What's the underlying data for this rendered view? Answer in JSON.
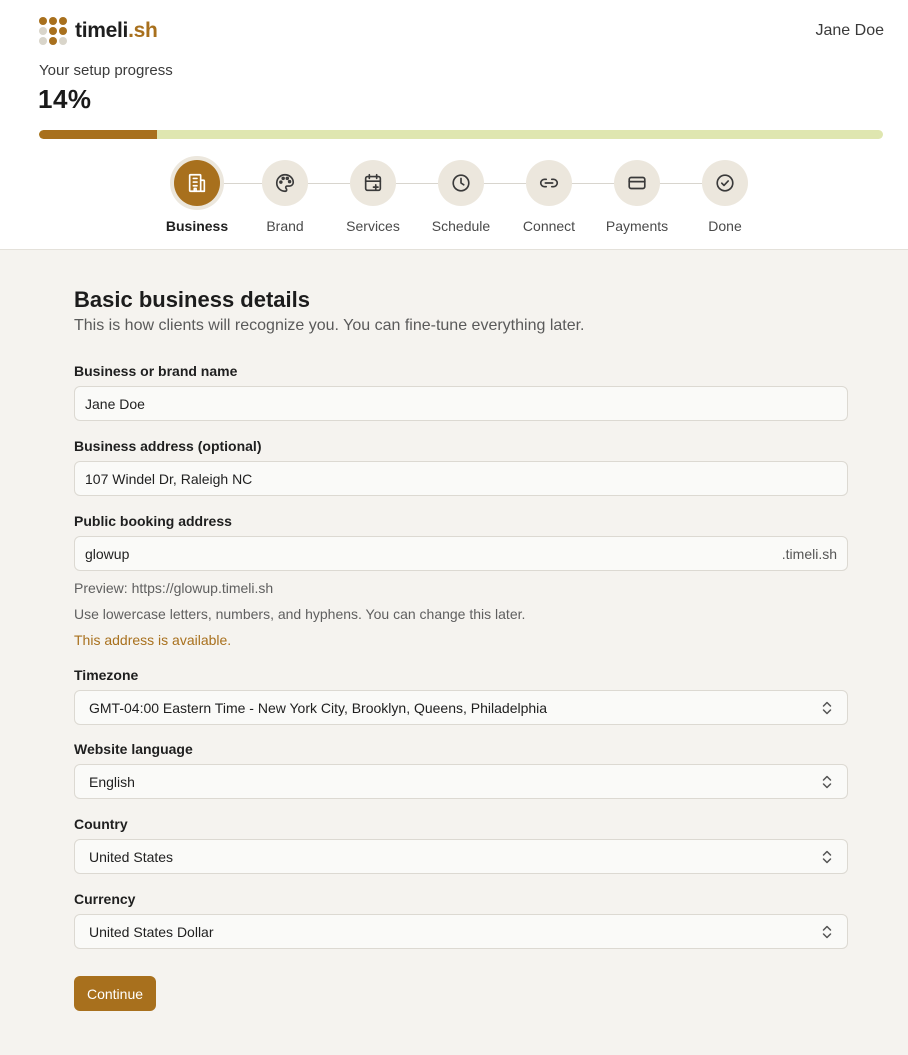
{
  "app": {
    "logo_text_main": "timeli",
    "logo_text_accent": ".sh",
    "user_name": "Jane Doe",
    "colors": {
      "accent": "#a8701d",
      "track": "#dfe6b0",
      "dots_gold": "#a8701d",
      "dots_light": "#d9d5ca"
    }
  },
  "progress": {
    "label": "Your setup progress",
    "percent_text": "14%",
    "fraction": 0.14
  },
  "steps": [
    {
      "label": "Business",
      "icon": "building-icon",
      "active": true
    },
    {
      "label": "Brand",
      "icon": "palette-icon",
      "active": false
    },
    {
      "label": "Services",
      "icon": "calendar-plus-icon",
      "active": false
    },
    {
      "label": "Schedule",
      "icon": "clock-icon",
      "active": false
    },
    {
      "label": "Connect",
      "icon": "link-icon",
      "active": false
    },
    {
      "label": "Payments",
      "icon": "credit-card-icon",
      "active": false
    },
    {
      "label": "Done",
      "icon": "check-circle-icon",
      "active": false
    }
  ],
  "form": {
    "title": "Basic business details",
    "subtitle": "This is how clients will recognize you. You can fine-tune everything later.",
    "business_name": {
      "label": "Business or brand name",
      "value": "Jane Doe"
    },
    "business_address": {
      "label": "Business address (optional)",
      "value": "107 Windel Dr, Raleigh NC"
    },
    "booking_address": {
      "label": "Public booking address",
      "value": "glowup",
      "suffix": ".timeli.sh",
      "preview": "Preview: https://glowup.timeli.sh",
      "help": "Use lowercase letters, numbers, and hyphens. You can change this later.",
      "status": "This address is available."
    },
    "timezone": {
      "label": "Timezone",
      "value": "GMT-04:00 Eastern Time - New York City, Brooklyn, Queens, Philadelphia"
    },
    "language": {
      "label": "Website language",
      "value": "English"
    },
    "country": {
      "label": "Country",
      "value": "United States"
    },
    "currency": {
      "label": "Currency",
      "value": "United States Dollar"
    },
    "continue_label": "Continue"
  }
}
